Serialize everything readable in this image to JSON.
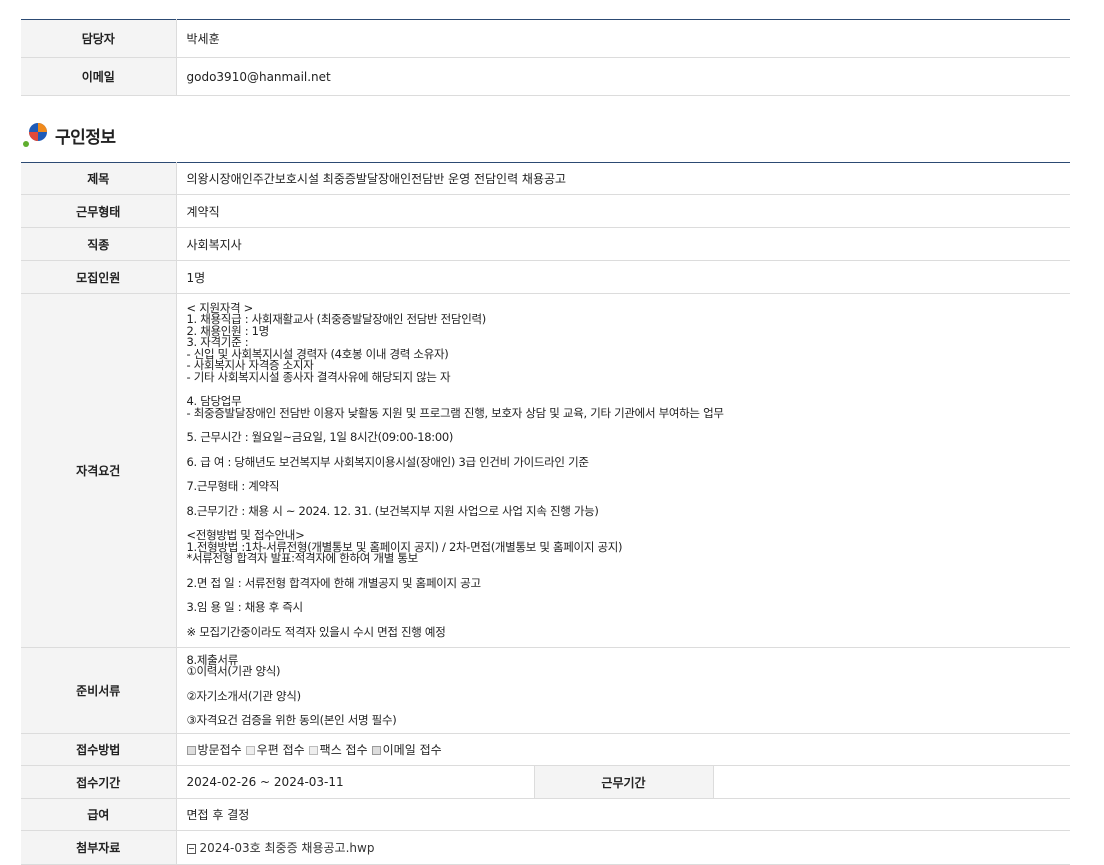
{
  "contact": {
    "rows": [
      {
        "label": "담당자",
        "value": "박세훈"
      },
      {
        "label": "이메일",
        "value": "godo3910@hanmail.net"
      }
    ]
  },
  "job_section": {
    "title": "구인정보",
    "title_label": {
      "label": "제목",
      "value": "의왕시장애인주간보호시설 최중증발달장애인전담반 운영 전담인력 채용공고"
    },
    "employment_type": {
      "label": "근무형태",
      "value": "계약직"
    },
    "occupation": {
      "label": "직종",
      "value": "사회복지사"
    },
    "headcount": {
      "label": "모집인원",
      "value": "1명"
    },
    "qualifications": {
      "label": "자격요건",
      "groups": [
        [
          "< 지원자격 >",
          "1. 채용직급 : 사회재활교사 (최중증발달장애인 전담반 전담인력)",
          "2. 채용인원 : 1명",
          "3. 자격기준 :",
          "- 신입 및 사회복지시설 경력자 (4호봉 이내 경력 소유자)",
          "- 사회복지사 자격증 소지자",
          "- 기타 사회복지시설 종사자 결격사유에 해당되지 않는 자"
        ],
        [
          "4. 담당업무",
          "- 최중증발달장애인 전담반 이용자 낮활동 지원 및 프로그램 진행, 보호자 상담 및 교육, 기타 기관에서 부여하는 업무"
        ],
        [
          "5. 근무시간 : 월요일~금요일, 1일 8시간(09:00-18:00)"
        ],
        [
          "6. 급 여 : 당해년도 보건복지부 사회복지이용시설(장애인) 3급 인건비 가이드라인 기준"
        ],
        [
          "7.근무형태 : 계약직"
        ],
        [
          "8.근무기간 : 채용 시 ~ 2024. 12. 31. (보건복지부 지원 사업으로 사업 지속 진행 가능)"
        ],
        [
          "<전형방법 및 접수안내>",
          "1.전형방법 :1차-서류전형(개별통보 및 홈페이지 공지) / 2차-면접(개별통보 및 홈페이지 공지)",
          "*서류전형 합격자 발표:적격자에 한하여 개별 통보"
        ],
        [
          "2.면 접 일 : 서류전형 합격자에 한해 개별공지 및 홈페이지 공고"
        ],
        [
          "3.임 용 일 : 채용 후 즉시"
        ],
        [
          "※ 모집기간중이라도 적격자 있을시 수시 면접 진행 예정"
        ]
      ]
    },
    "documents": {
      "label": "준비서류",
      "groups": [
        [
          "8.제출서류",
          "①이력서(기관 양식)"
        ],
        [
          "②자기소개서(기관 양식)"
        ],
        [
          "③자격요건 검증을 위한 동의(본인 서명 필수)"
        ]
      ]
    },
    "apply_method": {
      "label": "접수방법",
      "options": [
        {
          "label": "방문접수",
          "checked": true
        },
        {
          "label": "우편 접수",
          "checked": false
        },
        {
          "label": "팩스 접수",
          "checked": false
        },
        {
          "label": "이메일 접수",
          "checked": true
        }
      ]
    },
    "period": {
      "label": "접수기간",
      "value": "2024-02-26 ~ 2024-03-11",
      "work_label": "근무기간",
      "work_value": ""
    },
    "salary": {
      "label": "급여",
      "value": "면접 후 결정"
    },
    "attachment": {
      "label": "첨부자료",
      "file": "2024-03호 최중증 채용공고.hwp",
      "icon": "file-icon"
    }
  },
  "colors": {
    "accent_line": "#2c4a73",
    "header_bg": "#f4f4f4",
    "border": "#dcdcdc",
    "logo_blue": "#1e5bb8",
    "logo_orange": "#f08a1c",
    "logo_green": "#5fae2e"
  }
}
